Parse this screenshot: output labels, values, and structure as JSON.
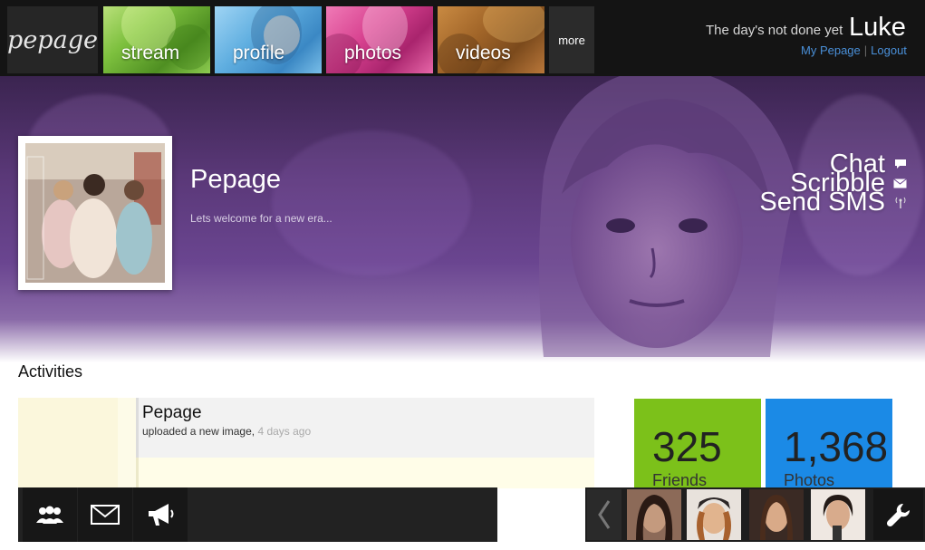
{
  "app": {
    "logo": "pepage"
  },
  "nav": {
    "tiles": [
      {
        "label": "stream"
      },
      {
        "label": "profile"
      },
      {
        "label": "photos"
      },
      {
        "label": "videos"
      }
    ],
    "more_label": "more"
  },
  "user": {
    "greeting": "The day's not done yet",
    "name": "Luke",
    "links": {
      "my_pepage": "My Pepage",
      "logout": "Logout"
    }
  },
  "profile": {
    "name": "Pepage",
    "tagline": "Lets welcome for a new era...",
    "actions": [
      {
        "label": "Chat",
        "icon": "speech-bubble-icon"
      },
      {
        "label": "Scribble",
        "icon": "envelope-icon"
      },
      {
        "label": "Send SMS",
        "icon": "antenna-icon"
      }
    ]
  },
  "activities": {
    "title": "Activities",
    "items": [
      {
        "author": "Pepage",
        "text": "uploaded a new image,",
        "time": "4 days ago"
      }
    ]
  },
  "stats": {
    "friends": {
      "value": "325",
      "label": "Friends",
      "color": "#7cc11a"
    },
    "photos": {
      "value": "1,368",
      "label": "Photos",
      "color": "#1b8ae6"
    }
  },
  "dock": {
    "buttons": [
      "people-icon",
      "envelope-icon",
      "megaphone-icon"
    ]
  },
  "friends_strip": {
    "prev_icon": "chevron-left-icon",
    "tools_icon": "wrench-icon"
  }
}
